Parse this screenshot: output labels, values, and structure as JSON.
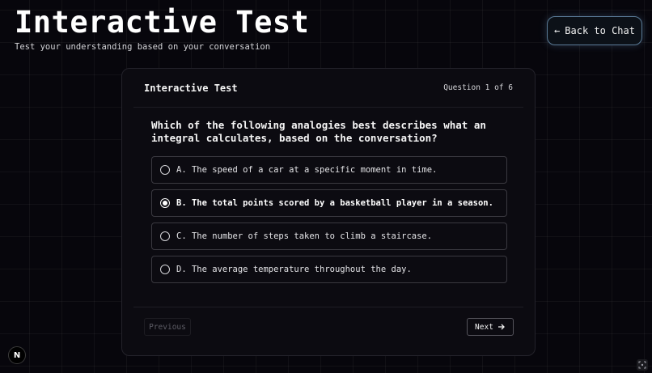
{
  "header": {
    "title": "Interactive Test",
    "subtitle": "Test your understanding based on your conversation",
    "back_label": "Back to Chat",
    "back_icon": "←"
  },
  "quiz": {
    "card_title": "Interactive Test",
    "progress": "Question 1 of 6",
    "question": "Which of the following analogies best describes what an integral calculates, based on the conversation?",
    "options": [
      {
        "label": "A. The speed of a car at a specific moment in time.",
        "selected": false
      },
      {
        "label": "B. The total points scored by a basketball player in a season.",
        "selected": true
      },
      {
        "label": "C. The number of steps taken to climb a staircase.",
        "selected": false
      },
      {
        "label": "D. The average temperature throughout the day.",
        "selected": false
      }
    ],
    "previous_label": "Previous",
    "next_label": "Next",
    "next_icon": "arrow-right-icon"
  },
  "footer": {
    "badge_letter": "N"
  },
  "colors": {
    "background": "#07060c",
    "card": "#0c0b11",
    "back_button_border": "#5a7a96"
  }
}
